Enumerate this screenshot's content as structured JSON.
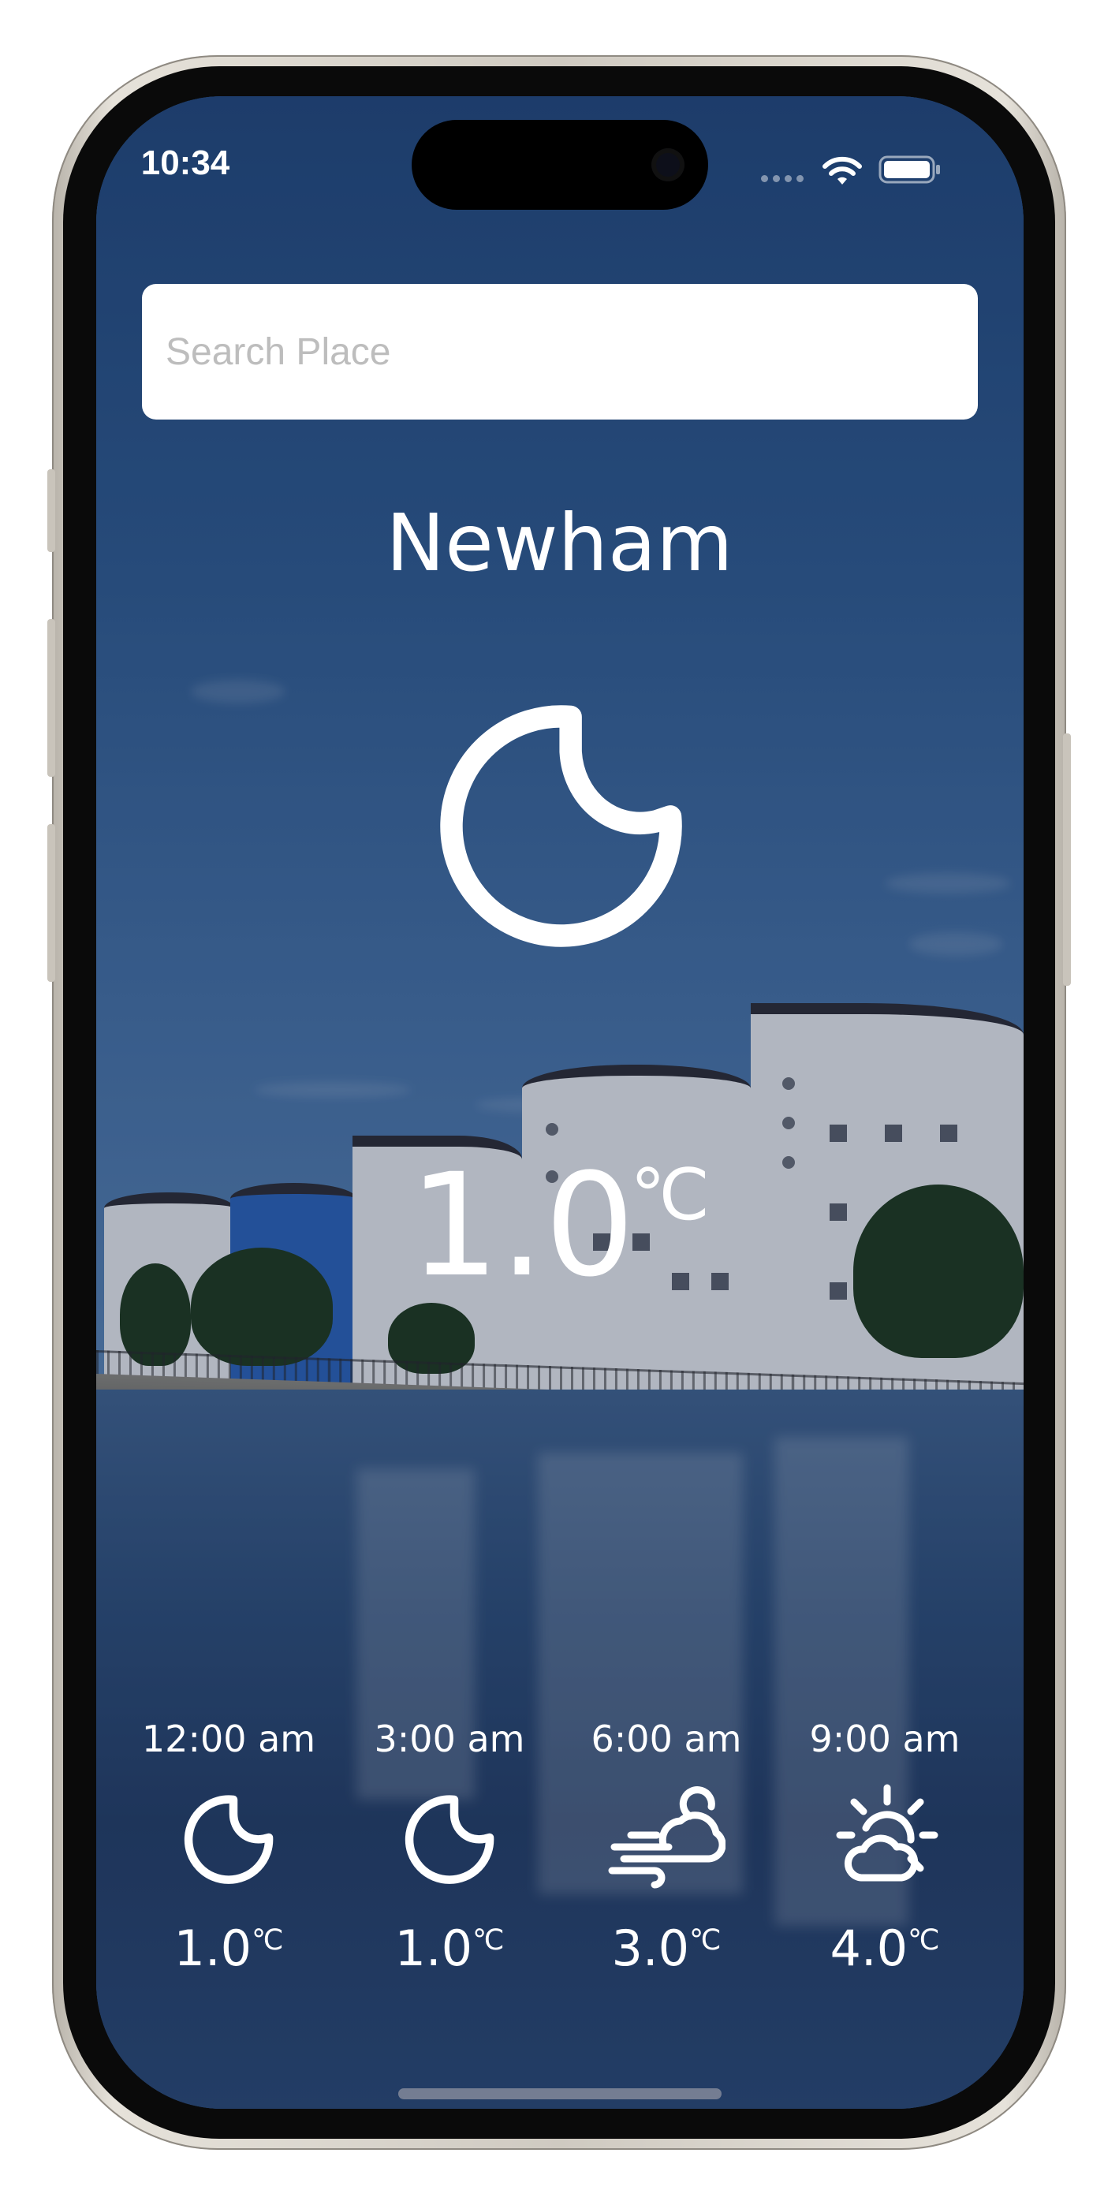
{
  "status_bar": {
    "time": "10:34",
    "wifi_icon": "wifi-icon",
    "battery_icon": "battery-icon"
  },
  "search": {
    "placeholder": "Search Place",
    "value": ""
  },
  "location": {
    "name": "Newham"
  },
  "current": {
    "icon": "moon-icon",
    "temperature": "1.0",
    "unit": "℃"
  },
  "forecast": [
    {
      "time": "12:00 am",
      "icon": "moon-icon",
      "temperature": "1.0",
      "unit": "℃"
    },
    {
      "time": "3:00 am",
      "icon": "moon-icon",
      "temperature": "1.0",
      "unit": "℃"
    },
    {
      "time": "6:00 am",
      "icon": "cloud-wind-icon",
      "temperature": "3.0",
      "unit": "℃"
    },
    {
      "time": "9:00 am",
      "icon": "sun-cloud-icon",
      "temperature": "4.0",
      "unit": "℃"
    }
  ],
  "colors": {
    "text": "#ffffff",
    "search_background": "#ffffff",
    "placeholder": "#bdbdbd"
  }
}
